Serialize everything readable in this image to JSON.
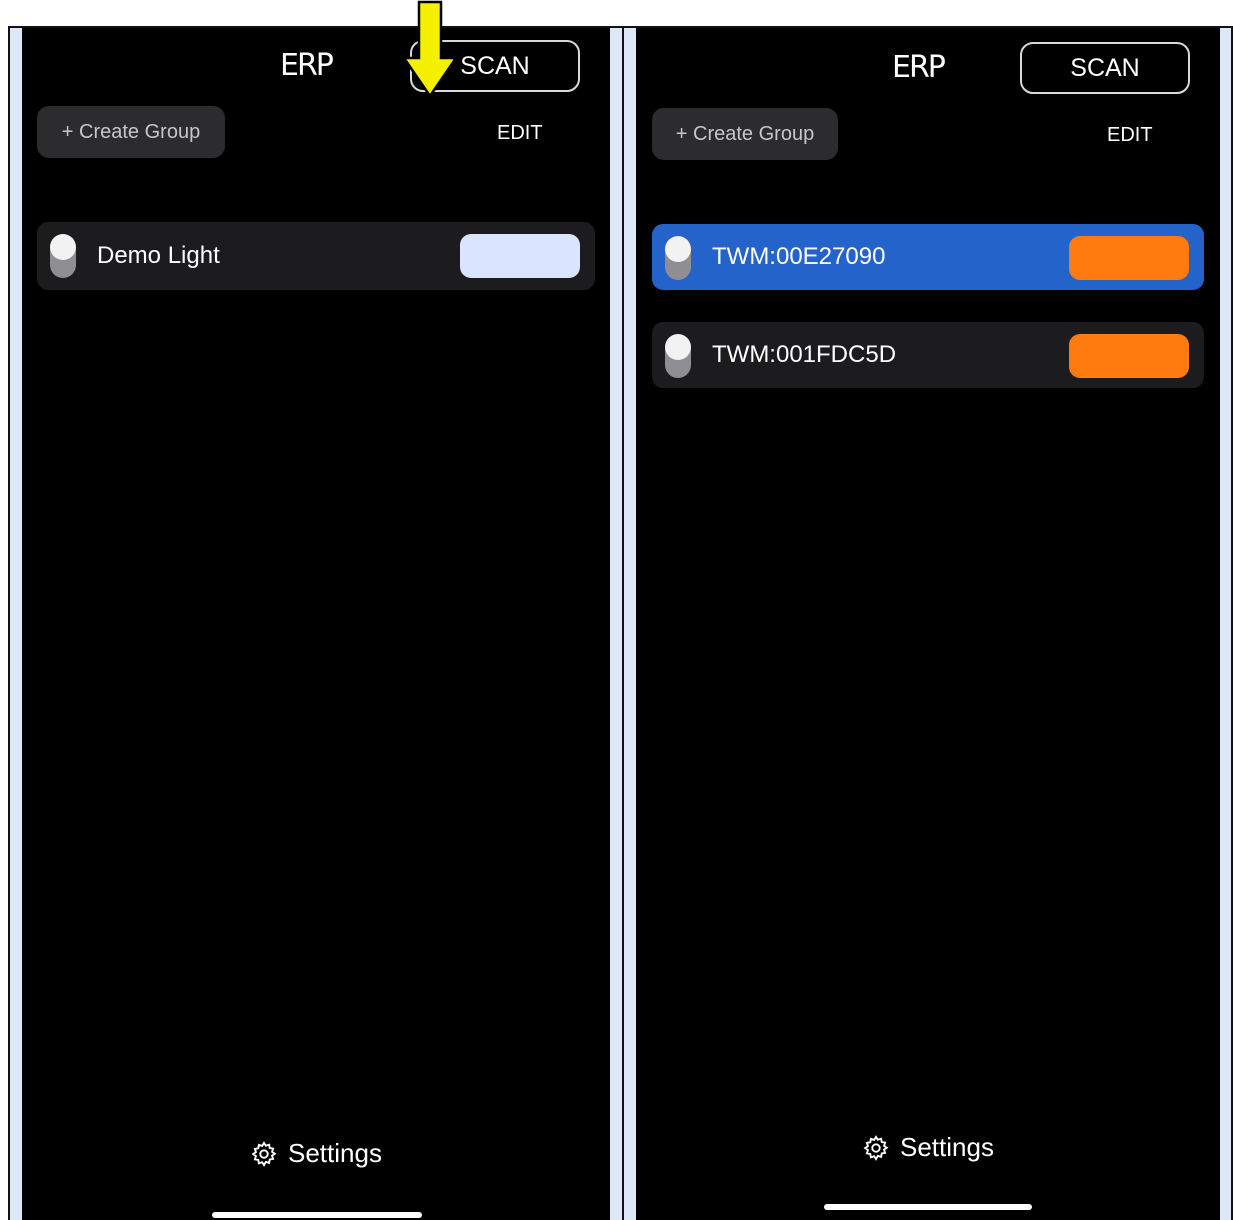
{
  "left_screen": {
    "logo": "ERP",
    "scan_label": "SCAN",
    "create_group_label": "+ Create Group",
    "edit_label": "EDIT",
    "devices": [
      {
        "name": "Demo Light",
        "selected": false,
        "color": "#dbe4ff"
      }
    ],
    "settings_label": "Settings"
  },
  "right_screen": {
    "logo": "ERP",
    "scan_label": "SCAN",
    "create_group_label": "+ Create Group",
    "edit_label": "EDIT",
    "devices": [
      {
        "name": "TWM:00E27090",
        "selected": true,
        "color": "#ff7a0f"
      },
      {
        "name": "TWM:001FDC5D",
        "selected": false,
        "color": "#ff7a0f"
      }
    ],
    "settings_label": "Settings"
  },
  "colors": {
    "selected_row": "#2463c9",
    "annotation_arrow": "#f5f000",
    "frame_background": "#dce8f5"
  },
  "icons": [
    "gear-icon",
    "down-arrow-annotation-icon"
  ]
}
